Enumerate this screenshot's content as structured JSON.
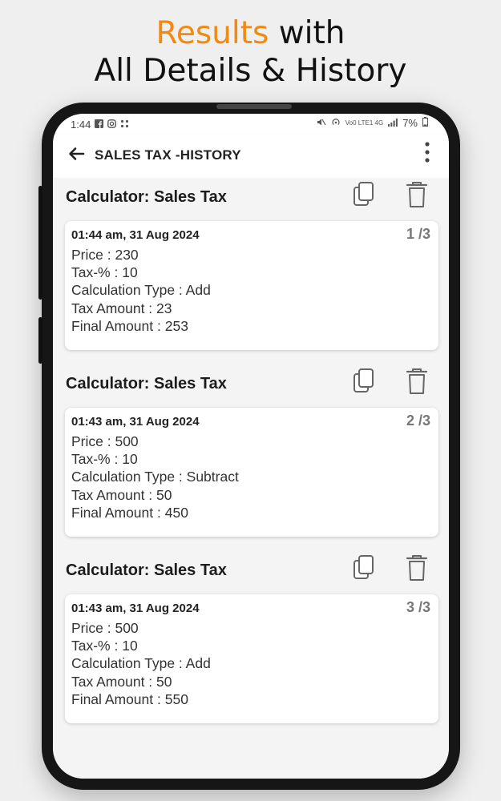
{
  "headline": {
    "accent": "Results",
    "rest1": " with",
    "line2": "All Details & History"
  },
  "status_bar": {
    "time": "1:44",
    "battery": "7%",
    "network": "Vo0 LTE1 4G"
  },
  "app_bar": {
    "title": "SALES TAX -HISTORY"
  },
  "entries": [
    {
      "title": "Calculator: Sales Tax",
      "timestamp": "01:44 am, 31 Aug 2024",
      "index": "1 /3",
      "lines": [
        "Price : 230",
        "Tax-% : 10",
        "Calculation Type : Add",
        "Tax Amount : 23",
        "Final Amount : 253"
      ]
    },
    {
      "title": "Calculator: Sales Tax",
      "timestamp": "01:43 am, 31 Aug 2024",
      "index": "2 /3",
      "lines": [
        "Price : 500",
        "Tax-% : 10",
        "Calculation Type : Subtract",
        "Tax Amount : 50",
        "Final Amount : 450"
      ]
    },
    {
      "title": "Calculator: Sales Tax",
      "timestamp": "01:43 am, 31 Aug 2024",
      "index": "3 /3",
      "lines": [
        "Price : 500",
        "Tax-% : 10",
        "Calculation Type : Add",
        "Tax Amount : 50",
        "Final Amount : 550"
      ]
    }
  ],
  "icons": {
    "back": "arrow-left-icon",
    "menu": "more-vertical-icon",
    "copy": "copy-icon",
    "delete": "trash-icon"
  },
  "colors": {
    "accent": "#f08a12",
    "background": "#efefef",
    "card": "#ffffff"
  }
}
